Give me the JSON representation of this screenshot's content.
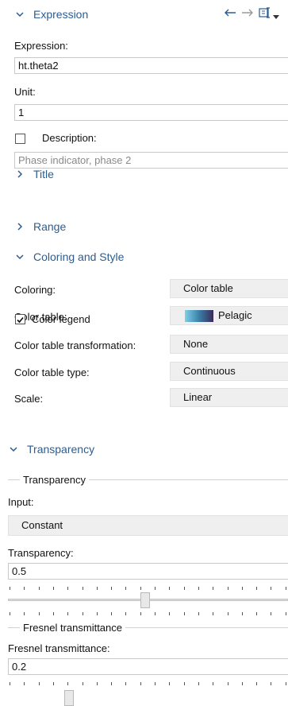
{
  "sections": {
    "expression": {
      "title": "Expression"
    },
    "title": {
      "title": "Title"
    },
    "range": {
      "title": "Range"
    },
    "coloring": {
      "title": "Coloring and Style"
    },
    "transparency": {
      "title": "Transparency"
    }
  },
  "toolbar": {
    "icons": [
      "arrow-left-icon",
      "arrow-right-icon",
      "replace-expression-icon",
      "dropdown-arrow-icon"
    ]
  },
  "expression": {
    "label": "Expression:",
    "value": "ht.theta2",
    "unit_label": "Unit:",
    "unit_value": "1",
    "description_label": "Description:",
    "description_checked": false,
    "description_value": "Phase indicator, phase 2"
  },
  "coloring": {
    "coloring_label": "Coloring:",
    "coloring_value": "Color table",
    "color_table_label": "Color table:",
    "color_table_value": "Pelagic",
    "color_legend_label": "Color legend",
    "color_legend_checked": true,
    "transformation_label": "Color table transformation:",
    "transformation_value": "None",
    "type_label": "Color table type:",
    "type_value": "Continuous",
    "scale_label": "Scale:",
    "scale_value": "Linear"
  },
  "transparency": {
    "group_label": "Transparency",
    "input_label": "Input:",
    "input_value": "Constant",
    "transparency_label": "Transparency:",
    "transparency_value": "0.5",
    "transparency_slider_level": 0.5,
    "fresnel_group_label": "Fresnel transmittance",
    "fresnel_label": "Fresnel transmittance:",
    "fresnel_value": "0.2",
    "fresnel_slider_level": 0.2
  },
  "colors": {
    "accent": "#2a5d94",
    "combo_bg": "#efefef",
    "pelagic_gradient": [
      "#7ed0e6",
      "#3a7fa8",
      "#3b2a5a"
    ]
  }
}
